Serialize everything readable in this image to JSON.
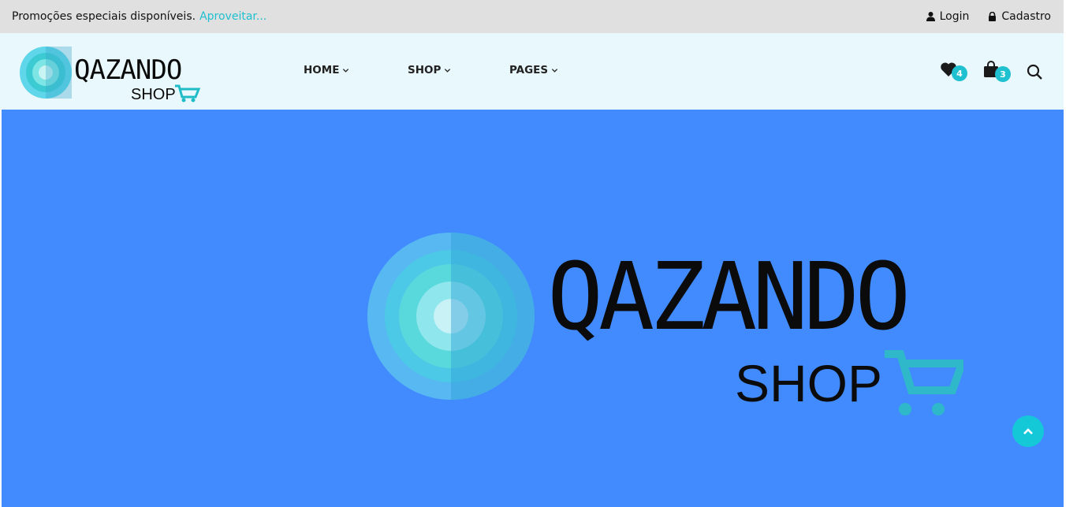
{
  "topbar": {
    "promo_text": "Promoções especiais disponíveis.",
    "promo_link": "Aproveitar...",
    "login_label": "Login",
    "signup_label": "Cadastro"
  },
  "brand": {
    "name": "Qazando",
    "tagline": "SHOP",
    "accent_color": "#1fc0cf",
    "hero_background": "#418bff"
  },
  "nav": {
    "items": [
      {
        "label": "HOME",
        "icon": "chevron-down-icon"
      },
      {
        "label": "SHOP",
        "icon": "chevron-down-icon"
      },
      {
        "label": "PAGES",
        "icon": "chevron-down-icon"
      }
    ]
  },
  "header_icons": {
    "wishlist": {
      "icon": "heart-icon",
      "count": "4"
    },
    "cart": {
      "icon": "shopping-bag-icon",
      "count": "3"
    },
    "search": {
      "icon": "search-icon"
    }
  },
  "hero": {
    "logo_wordmark": "Qazando",
    "logo_tagline": "SHOP"
  },
  "back_to_top": {
    "icon": "chevron-up-icon"
  }
}
